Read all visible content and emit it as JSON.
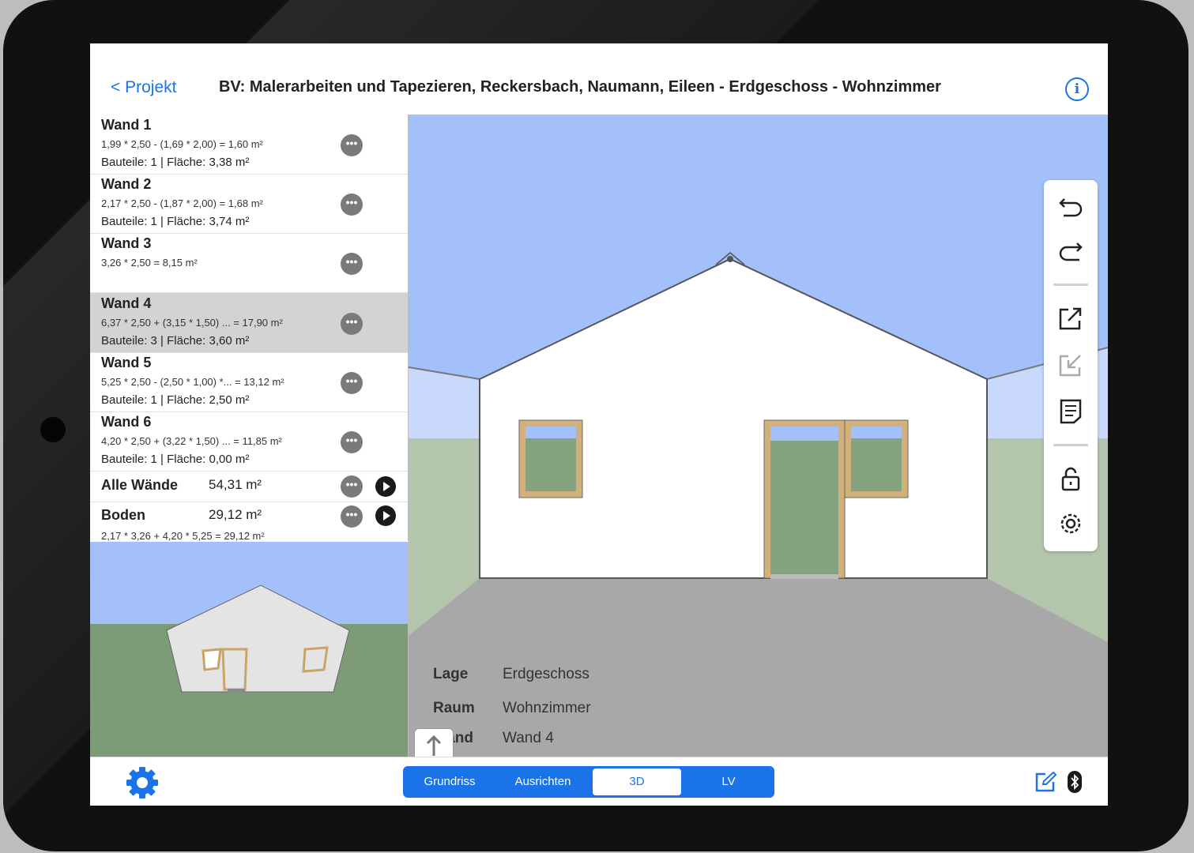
{
  "nav": {
    "back_label": "< Projekt",
    "title": "BV: Malerarbeiten und Tapezieren, Reckersbach, Naumann, Eileen - Erdgeschoss - Wohnzimmer",
    "info_glyph": "i"
  },
  "walls": [
    {
      "name": "Wand 1",
      "formula": "1,99 * 2,50  - (1,69 * 2,00)   = 1,60 m²",
      "summary": "Bauteile: 1 | Fläche: 3,38 m²",
      "selected": false
    },
    {
      "name": "Wand 2",
      "formula": "2,17 * 2,50  - (1,87 * 2,00)   = 1,68 m²",
      "summary": "Bauteile: 1 | Fläche: 3,74 m²",
      "selected": false
    },
    {
      "name": "Wand 3",
      "formula": "3,26 * 2,50   = 8,15 m²",
      "summary": "",
      "selected": false
    },
    {
      "name": "Wand 4",
      "formula": "6,37 * 2,50   + (3,15 * 1,50) ... = 17,90 m²",
      "summary": "Bauteile: 3 | Fläche: 3,60 m²",
      "selected": true
    },
    {
      "name": "Wand 5",
      "formula": "5,25 * 2,50  - (2,50 * 1,00) *... = 13,12 m²",
      "summary": "Bauteile: 1 | Fläche: 2,50 m²",
      "selected": false
    },
    {
      "name": "Wand 6",
      "formula": "4,20 * 2,50   + (3,22 * 1,50) ... = 11,85 m²",
      "summary": "Bauteile: 1 | Fläche: 0,00 m²",
      "selected": false
    }
  ],
  "totals": {
    "all_walls_label": "Alle Wände",
    "all_walls_value": "54,31 m²",
    "floor_label": "Boden",
    "floor_value": "29,12 m²",
    "floor_formula": "2,17 * 3,26  + 4,20 * 5,25  = 29,12 m²"
  },
  "more_glyph": "•••",
  "info_panel": {
    "lage_label": "Lage",
    "lage_value": "Erdgeschoss",
    "raum_label": "Raum",
    "raum_value": "Wohnzimmer",
    "wand_label": "Wand",
    "wand_value": "Wand 4"
  },
  "toolbar": [
    "undo-icon",
    "redo-icon",
    "export-icon",
    "import-icon",
    "notes-icon",
    "lock-icon",
    "settings-icon"
  ],
  "tabs": {
    "grundriss": "Grundriss",
    "ausrichten": "Ausrichten",
    "d3": "3D",
    "lv": "LV",
    "active": "3D"
  },
  "colors": {
    "accent": "#1a73e8",
    "sky": "#a3c0fb",
    "grass": "#b3c6ac",
    "floor": "#a8a8a8",
    "wall": "#ffffff",
    "window_frame": "#d1b07a",
    "window_glass": "#85a380"
  }
}
